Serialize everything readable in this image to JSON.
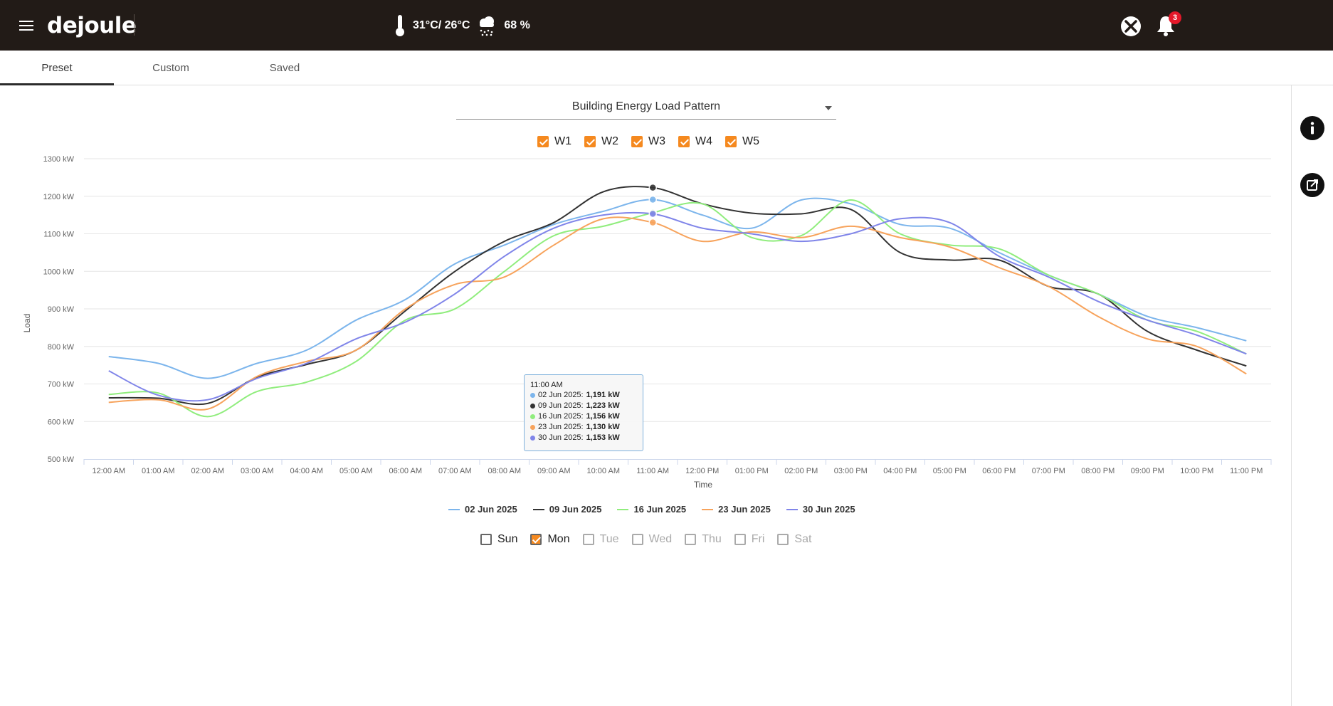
{
  "header": {
    "logo": "dejoule",
    "temperature": "31°C/ 26°C",
    "humidity": "68 %",
    "notifications_count": "3"
  },
  "tabs": [
    {
      "label": "Preset",
      "active": true
    },
    {
      "label": "Custom",
      "active": false
    },
    {
      "label": "Saved",
      "active": false
    }
  ],
  "dropdown": {
    "selected": "Building Energy Load Pattern"
  },
  "weeks": [
    {
      "label": "W1",
      "checked": true
    },
    {
      "label": "W2",
      "checked": true
    },
    {
      "label": "W3",
      "checked": true
    },
    {
      "label": "W4",
      "checked": true
    },
    {
      "label": "W5",
      "checked": true
    }
  ],
  "tooltip": {
    "time": "11:00 AM",
    "rows": [
      {
        "date": "02 Jun 2025",
        "value": "1,191 kW",
        "color": "#7cb5ec"
      },
      {
        "date": "09 Jun 2025",
        "value": "1,223 kW",
        "color": "#333333"
      },
      {
        "date": "16 Jun 2025",
        "value": "1,156 kW",
        "color": "#90ed7d"
      },
      {
        "date": "23 Jun 2025",
        "value": "1,130 kW",
        "color": "#f7a35c"
      },
      {
        "date": "30 Jun 2025",
        "value": "1,153 kW",
        "color": "#8085e9"
      }
    ]
  },
  "days": [
    {
      "label": "Sun",
      "checked": false,
      "enabled": true
    },
    {
      "label": "Mon",
      "checked": true,
      "enabled": true
    },
    {
      "label": "Tue",
      "checked": false,
      "enabled": false
    },
    {
      "label": "Wed",
      "checked": false,
      "enabled": false
    },
    {
      "label": "Thu",
      "checked": false,
      "enabled": false
    },
    {
      "label": "Fri",
      "checked": false,
      "enabled": false
    },
    {
      "label": "Sat",
      "checked": false,
      "enabled": false
    }
  ],
  "chart_data": {
    "type": "line",
    "xlabel": "Time",
    "ylabel": "Load",
    "ylim": [
      500,
      1300
    ],
    "y_ticks": [
      "500 kW",
      "600 kW",
      "700 kW",
      "800 kW",
      "900 kW",
      "1000 kW",
      "1100 kW",
      "1200 kW",
      "1300 kW"
    ],
    "grid": true,
    "legend_position": "bottom",
    "categories": [
      "12:00 AM",
      "01:00 AM",
      "02:00 AM",
      "03:00 AM",
      "04:00 AM",
      "05:00 AM",
      "06:00 AM",
      "07:00 AM",
      "08:00 AM",
      "09:00 AM",
      "10:00 AM",
      "11:00 AM",
      "12:00 PM",
      "01:00 PM",
      "02:00 PM",
      "03:00 PM",
      "04:00 PM",
      "05:00 PM",
      "06:00 PM",
      "07:00 PM",
      "08:00 PM",
      "09:00 PM",
      "10:00 PM",
      "11:00 PM"
    ],
    "series": [
      {
        "name": "02 Jun 2025",
        "color": "#7cb5ec",
        "values": [
          773,
          755,
          715,
          755,
          790,
          870,
          925,
          1020,
          1070,
          1125,
          1160,
          1191,
          1150,
          1115,
          1190,
          1180,
          1125,
          1115,
          1050,
          990,
          940,
          880,
          850,
          815
        ]
      },
      {
        "name": "09 Jun 2025",
        "color": "#333333",
        "values": [
          663,
          662,
          648,
          718,
          752,
          790,
          895,
          1000,
          1080,
          1130,
          1212,
          1223,
          1180,
          1155,
          1153,
          1165,
          1050,
          1030,
          1030,
          960,
          940,
          840,
          790,
          748
        ]
      },
      {
        "name": "16 Jun 2025",
        "color": "#90ed7d",
        "values": [
          672,
          676,
          613,
          680,
          705,
          760,
          870,
          900,
          1000,
          1095,
          1120,
          1156,
          1180,
          1090,
          1095,
          1190,
          1100,
          1070,
          1060,
          990,
          940,
          870,
          840,
          780
        ]
      },
      {
        "name": "23 Jun 2025",
        "color": "#f7a35c",
        "values": [
          651,
          658,
          633,
          720,
          760,
          790,
          900,
          965,
          985,
          1070,
          1140,
          1130,
          1080,
          1105,
          1090,
          1120,
          1090,
          1065,
          1010,
          960,
          880,
          820,
          800,
          727
        ]
      },
      {
        "name": "30 Jun 2025",
        "color": "#8085e9",
        "values": [
          735,
          670,
          658,
          715,
          755,
          820,
          865,
          940,
          1040,
          1115,
          1150,
          1153,
          1115,
          1100,
          1080,
          1100,
          1140,
          1130,
          1040,
          985,
          920,
          870,
          830,
          780
        ]
      }
    ]
  }
}
